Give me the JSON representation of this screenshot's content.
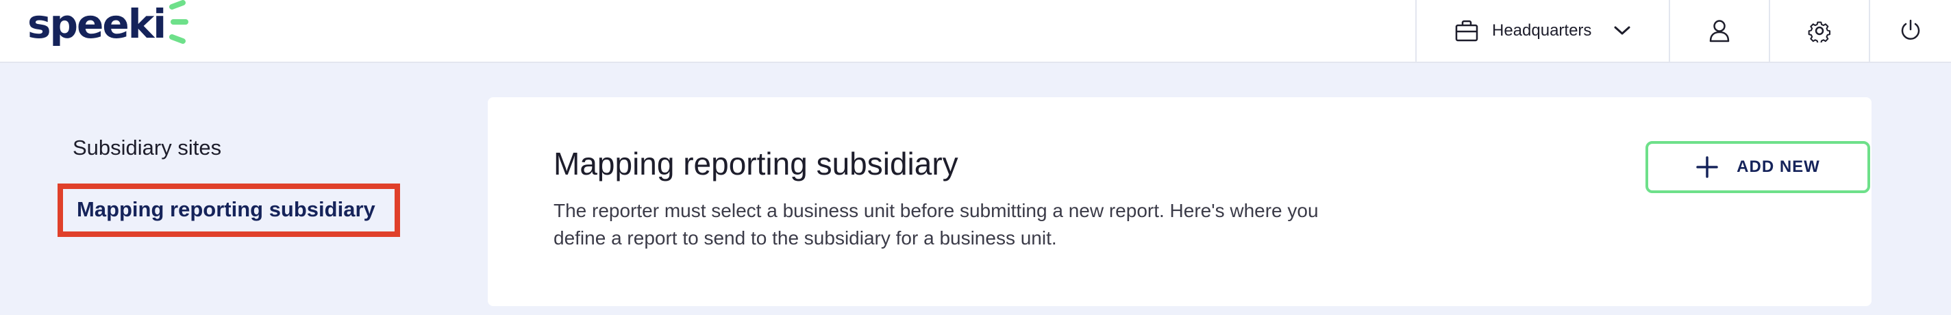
{
  "brand": {
    "name": "speeki",
    "accent_color": "#6ee08a",
    "text_color": "#15235a"
  },
  "header": {
    "location_selector": {
      "label": "Headquarters",
      "icon": "briefcase-icon",
      "dropdown_icon": "chevron-down-icon"
    },
    "actions": [
      {
        "icon": "user-icon"
      },
      {
        "icon": "gear-icon"
      },
      {
        "icon": "power-icon"
      }
    ]
  },
  "sidebar": {
    "items": [
      {
        "label": "Subsidiary sites",
        "active": false
      },
      {
        "label": "Mapping reporting subsidiary",
        "active": true
      }
    ],
    "highlight_color": "#e0402a"
  },
  "main": {
    "title": "Mapping reporting subsidiary",
    "description": "The reporter must select a business unit before submitting a new report. Here's where you define a report to send to the subsidiary for a business unit.",
    "add_button": {
      "label": "ADD NEW",
      "icon": "plus-icon"
    }
  }
}
